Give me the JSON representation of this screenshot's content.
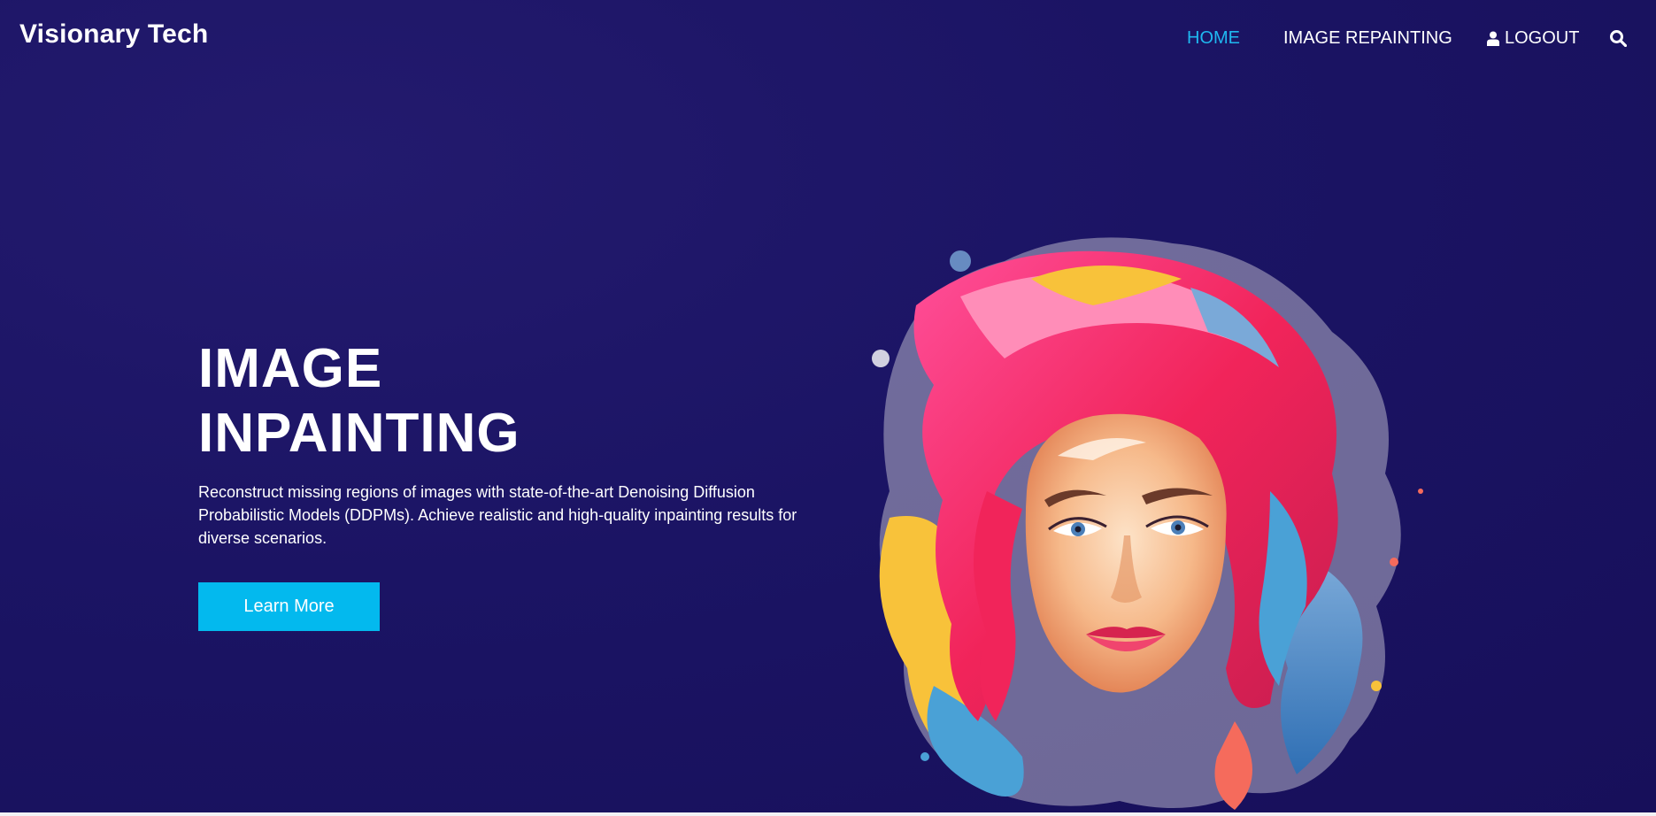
{
  "brand": {
    "name": "Visionary Tech"
  },
  "nav": {
    "home": "HOME",
    "image_repainting": "IMAGE REPAINTING",
    "logout": "LOGOUT",
    "icons": {
      "user": "user-icon",
      "search": "search-icon"
    }
  },
  "hero": {
    "title_line1": "IMAGE",
    "title_line2": "INPAINTING",
    "description": "Reconstruct missing regions of images with state-of-the-art Denoising Diffusion Probabilistic Models (DDPMs). Achieve realistic and high-quality inpainting results for diverse scenarios.",
    "cta_label": "Learn More"
  },
  "colors": {
    "background": "#1b1464",
    "accent": "#03b9ee",
    "nav_active": "#1fb8f0",
    "text": "#ffffff"
  }
}
